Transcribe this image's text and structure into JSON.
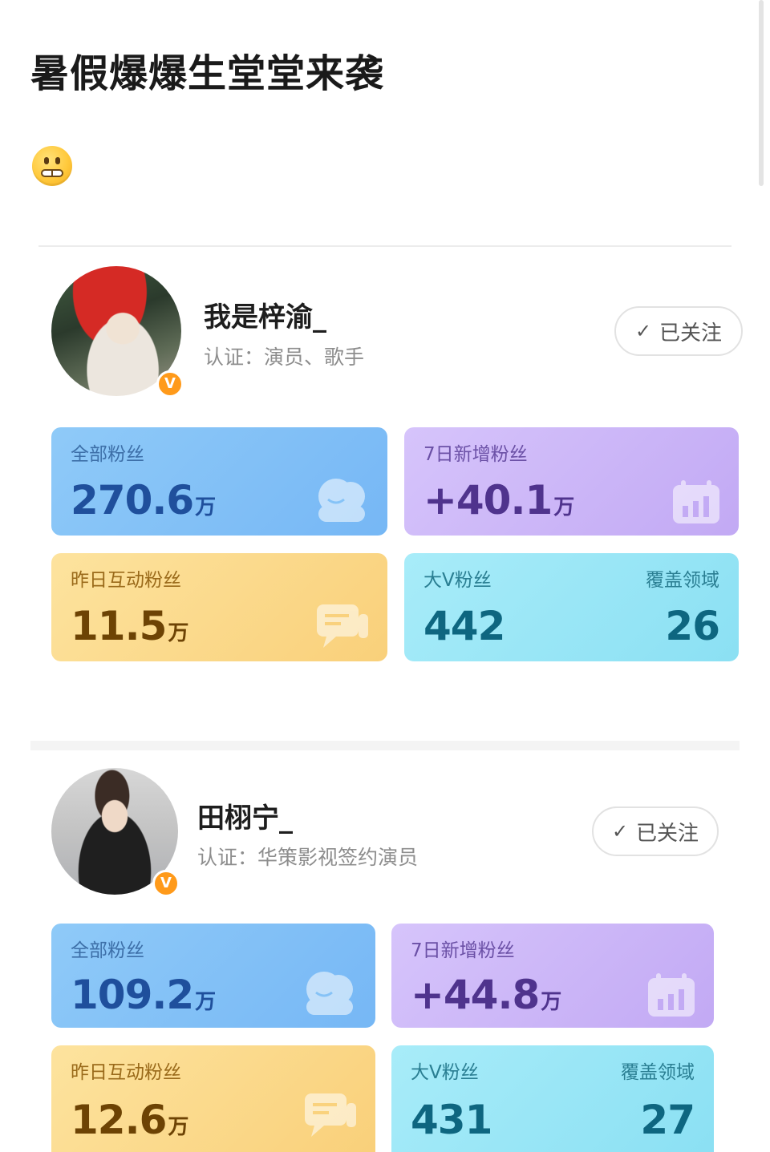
{
  "post": {
    "title": "暑假爆爆生堂堂来袭"
  },
  "profiles": [
    {
      "name": "我是梓渝_",
      "cert": "认证：演员、歌手",
      "badge": "V",
      "follow_label": "已关注",
      "stats": {
        "total_fans_label": "全部粉丝",
        "total_fans_value": "270.6",
        "total_fans_unit": "万",
        "new_fans_label": "7日新增粉丝",
        "new_fans_value": "+40.1",
        "new_fans_unit": "万",
        "interact_label": "昨日互动粉丝",
        "interact_value": "11.5",
        "interact_unit": "万",
        "bigv_label": "大V粉丝",
        "bigv_value": "442",
        "coverage_label": "覆盖领域",
        "coverage_value": "26"
      }
    },
    {
      "name": "田栩宁_",
      "cert": "认证：华策影视签约演员",
      "badge": "V",
      "follow_label": "已关注",
      "stats": {
        "total_fans_label": "全部粉丝",
        "total_fans_value": "109.2",
        "total_fans_unit": "万",
        "new_fans_label": "7日新增粉丝",
        "new_fans_value": "+44.8",
        "new_fans_unit": "万",
        "interact_label": "昨日互动粉丝",
        "interact_value": "12.6",
        "interact_unit": "万",
        "bigv_label": "大V粉丝",
        "bigv_value": "431",
        "coverage_label": "覆盖领域",
        "coverage_value": "27"
      }
    }
  ],
  "colors": {
    "blue_tile": "#8fcaf8",
    "purple_tile": "#d6c4fb",
    "yellow_tile": "#fde39e",
    "cyan_tile": "#a8ecf9",
    "verified_badge": "#ff9a1a"
  },
  "icons": {
    "emoji": "grimacing-face-emoji",
    "follow": "check-icon",
    "fans": "people-icon",
    "growth": "bar-chart-icon",
    "interact": "chat-bubble-icon"
  }
}
